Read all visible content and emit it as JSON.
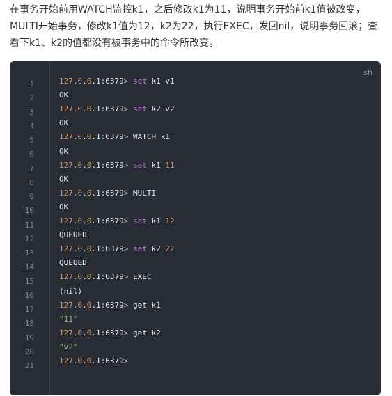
{
  "intro": {
    "line1": "在事务开始前用WATCH监控k1，之后修改k1为11，说明事务开始前k1值被改变，",
    "line2": "MULTI开始事务，修改k1值为12，k2为22，执行EXEC，发回nil，说明事务回滚；查",
    "line3": "看下k1、k2的值都没有被事务中的命令所改变。"
  },
  "code": {
    "language": "sh",
    "line_numbers": [
      "1",
      "2",
      "3",
      "4",
      "5",
      "6",
      "7",
      "8",
      "9",
      "10",
      "11",
      "12",
      "13",
      "14",
      "15",
      "16",
      "17",
      "18",
      "19",
      "20",
      "21"
    ],
    "prompt": {
      "a": "127",
      "dot1": ".",
      "b": "0",
      "dot2": ".",
      "c": "0",
      "rest": ".1:6379",
      "caret": ">"
    },
    "lines": [
      {
        "kind": "cmd",
        "keyword": "set",
        "args": "k1 v1",
        "num": ""
      },
      {
        "kind": "out",
        "text": "OK"
      },
      {
        "kind": "cmd",
        "keyword": "set",
        "args": "k2 v2",
        "num": ""
      },
      {
        "kind": "out",
        "text": "OK"
      },
      {
        "kind": "cmd",
        "keyword": "",
        "args": "WATCH k1",
        "num": ""
      },
      {
        "kind": "out",
        "text": "OK"
      },
      {
        "kind": "cmd",
        "keyword": "set",
        "args": "k1",
        "num": "11"
      },
      {
        "kind": "out",
        "text": "OK"
      },
      {
        "kind": "cmd",
        "keyword": "",
        "args": "MULTI",
        "num": ""
      },
      {
        "kind": "out",
        "text": "OK"
      },
      {
        "kind": "cmd",
        "keyword": "set",
        "args": "k1",
        "num": "12"
      },
      {
        "kind": "out",
        "text": "QUEUED"
      },
      {
        "kind": "cmd",
        "keyword": "set",
        "args": "k2",
        "num": "22"
      },
      {
        "kind": "out",
        "text": "QUEUED"
      },
      {
        "kind": "cmd",
        "keyword": "",
        "args": "EXEC",
        "num": ""
      },
      {
        "kind": "out",
        "text": "(nil)"
      },
      {
        "kind": "cmd",
        "keyword": "",
        "args": "get k1",
        "num": ""
      },
      {
        "kind": "str",
        "text": "\"11\""
      },
      {
        "kind": "cmd",
        "keyword": "",
        "args": "get k2",
        "num": ""
      },
      {
        "kind": "str",
        "text": "\"v2\""
      },
      {
        "kind": "prompt-only"
      }
    ]
  },
  "colors": {
    "background": "#282c34",
    "number": "#d19a66",
    "keyword": "#c678dd",
    "string": "#98c379",
    "text": "#e6e6e6"
  }
}
